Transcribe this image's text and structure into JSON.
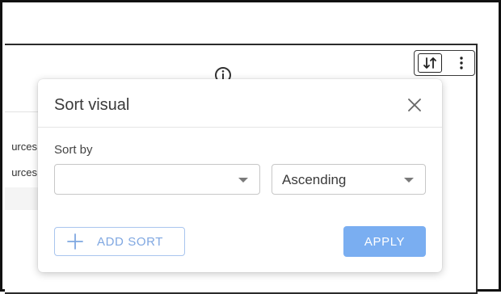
{
  "dialog": {
    "title": "Sort visual",
    "sort_by_label": "Sort by",
    "field_select": {
      "value": ""
    },
    "order_select": {
      "value": "Ascending"
    },
    "add_sort_label": "ADD SORT",
    "apply_label": "APPLY"
  },
  "background_table": {
    "row_texts": [
      "urces",
      "urces"
    ]
  },
  "icons": {
    "info": "info-icon",
    "sort_toggle": "sort-arrows-icon",
    "more": "more-vertical-icon",
    "close": "close-icon",
    "add": "plus-icon",
    "dropdown": "chevron-down-icon"
  },
  "colors": {
    "accent": "#7aaef1",
    "accent_text": "#7fa7e1",
    "frame": "#111111"
  }
}
